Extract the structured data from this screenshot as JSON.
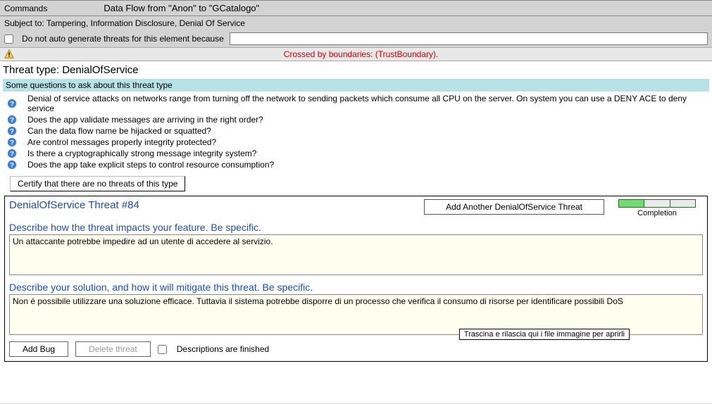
{
  "header": {
    "commands_label": "Commands",
    "title": "Data Flow from \"Anon\" to \"GCatalogo\""
  },
  "subject": "Subject to: Tampering, Information Disclosure, Denial Of Service",
  "auto_gen": {
    "checkbox_label": "Do not auto generate threats for this element because",
    "value": ""
  },
  "warning": "Crossed by boundaries: (TrustBoundary).",
  "threat_type": "Threat type: DenialOfService",
  "questions_header": "Some questions to ask about this threat type",
  "questions": [
    "Denial of service attacks on networks range from turning off the network to sending packets which consume all CPU on the server.  On system you can use a DENY ACE to deny service",
    "Does the app validate messages are arriving in the right order?",
    "Can the data flow name be hijacked or squatted?",
    "Are control messages properly integrity protected?",
    "Is there a cryptographically strong message integrity system?",
    "Does the app take explicit steps to control resource consumption?"
  ],
  "certify_label": "Certify that there are no threats of this type",
  "card": {
    "title": "DenialOfService Threat #84",
    "add_another": "Add Another DenialOfService Threat",
    "completion_label": "Completion",
    "impact_label": "Describe how the threat impacts your feature.  Be specific.",
    "impact_text": "Un attaccante potrebbe impedire ad un utente di accedere al servizio.",
    "solution_label": "Describe your solution, and how it will mitigate this threat.  Be specific.",
    "solution_text": "Non è possibile utilizzare una soluzione efficace. Tuttavia il sistema potrebbe disporre di un processo che verifica il consumo di risorse per identificare possibili DoS",
    "add_bug": "Add Bug",
    "delete_threat": "Delete threat",
    "descriptions_finished": "Descriptions are finished",
    "drag_hint": "Trascina e rilascia qui i file immagine per aprirli"
  }
}
